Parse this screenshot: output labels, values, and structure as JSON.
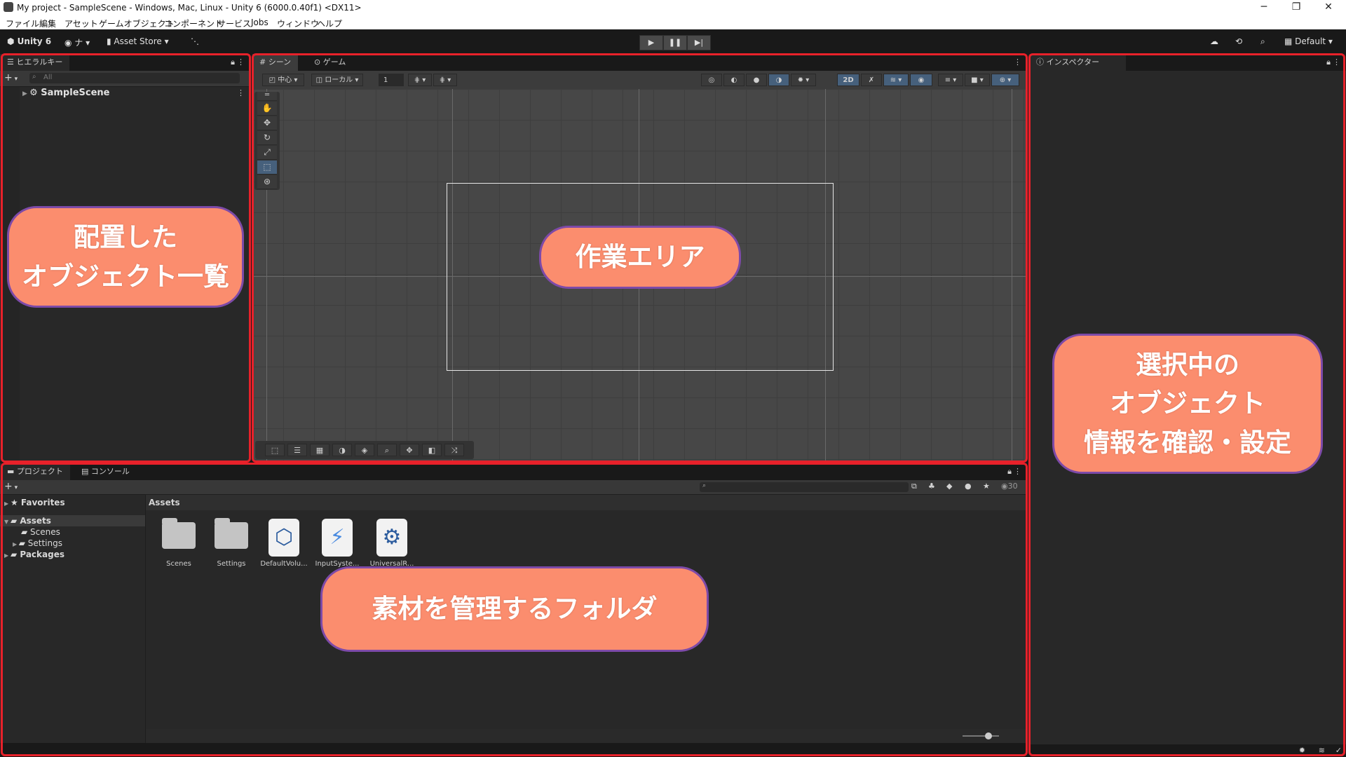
{
  "window": {
    "title": "My project - SampleScene - Windows, Mac, Linux - Unity 6 (6000.0.40f1) <DX11>",
    "controls": [
      "─",
      "❐",
      "✕"
    ]
  },
  "menu": [
    "ファイル",
    "編集",
    "アセット",
    "ゲームオブジェクト",
    "コンポーネント",
    "サービス",
    "Jobs",
    "ウィンドウ",
    "ヘルプ"
  ],
  "toolbar": {
    "unity_label": "Unity 6",
    "account": "ナ",
    "asset_store": "Asset Store",
    "play": "▶",
    "pause": "❚❚",
    "step": "▶|",
    "layout": "Default"
  },
  "hierarchy": {
    "tab": "ヒエラルキー",
    "search_placeholder": "All",
    "add": "+",
    "scene": "SampleScene"
  },
  "scene_view": {
    "tabs": [
      "シーン",
      "ゲーム"
    ],
    "pivot": "中心",
    "space": "ローカル",
    "grid_value": "1",
    "mode_2d": "2D"
  },
  "inspector": {
    "tab": "インスペクター"
  },
  "project": {
    "tabs": [
      "プロジェクト",
      "コンソール"
    ],
    "add": "+",
    "visible_count": "30",
    "breadcrumb": "Assets",
    "tree": [
      {
        "label": "Favorites",
        "bold": true
      },
      {
        "label": "Assets",
        "bold": true
      },
      {
        "label": "Scenes",
        "bold": false
      },
      {
        "label": "Settings",
        "bold": false
      },
      {
        "label": "Packages",
        "bold": true
      }
    ],
    "assets": [
      {
        "label": "Scenes",
        "icon": "folder-icon"
      },
      {
        "label": "Settings",
        "icon": "folder-icon"
      },
      {
        "label": "DefaultVolu...",
        "icon": "volume-profile-icon"
      },
      {
        "label": "InputSyste...",
        "icon": "input-actions-icon"
      },
      {
        "label": "UniversalR...",
        "icon": "render-pipeline-asset-icon"
      }
    ]
  },
  "callouts": {
    "hierarchy": [
      "配置した",
      "オブジェクト一覧"
    ],
    "scene": [
      "作業エリア"
    ],
    "inspector": [
      "選択中の",
      "オブジェクト",
      "情報を確認・設定"
    ],
    "project": [
      "素材を管理するフォルダ"
    ]
  },
  "colors": {
    "highlight_frame": "#e8212a",
    "callout_fill": "#fb8d6e",
    "callout_border": "#7d4aa8",
    "editor_bg": "#282828"
  }
}
